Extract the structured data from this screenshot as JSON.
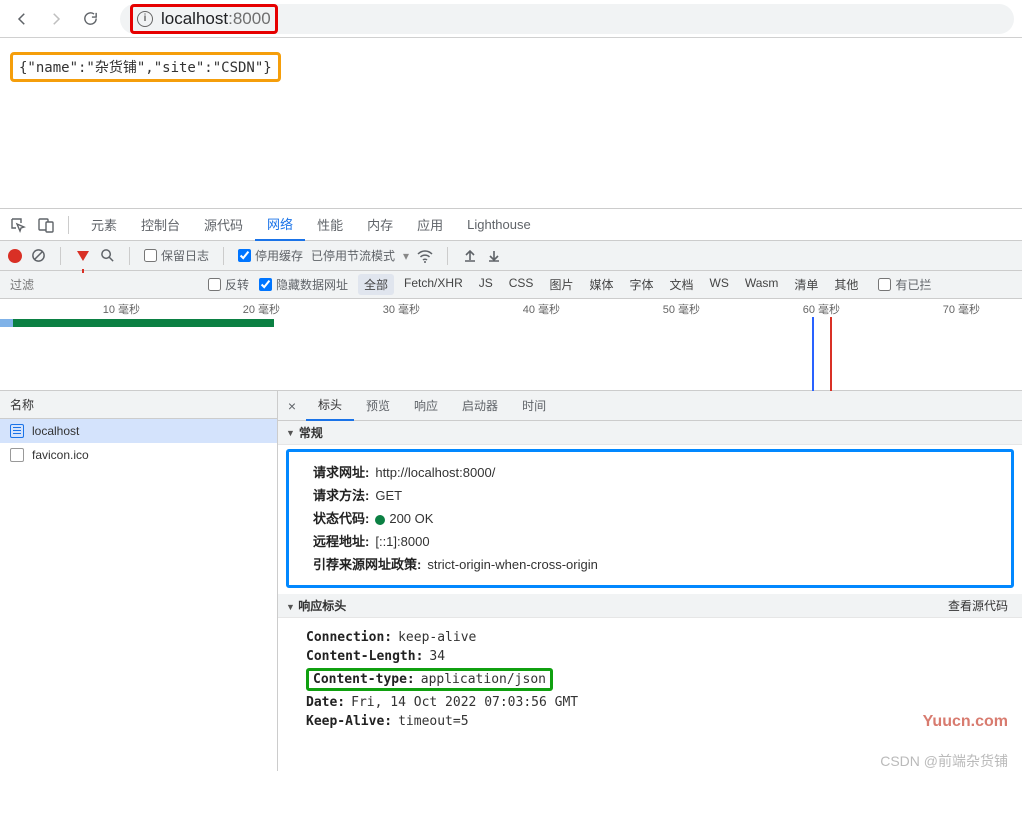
{
  "browser": {
    "address_host": "localhost",
    "address_port": ":8000"
  },
  "page_content": {
    "json_text": "{\"name\":\"杂货铺\",\"site\":\"CSDN\"}"
  },
  "devtools": {
    "tabs": [
      "元素",
      "控制台",
      "源代码",
      "网络",
      "性能",
      "内存",
      "应用",
      "Lighthouse"
    ],
    "active_tab": 3,
    "toolbar": {
      "preserve_log": "保留日志",
      "disable_cache": "停用缓存",
      "throttling_stopped": "已停用节流模式"
    },
    "filter": {
      "placeholder": "过滤",
      "invert": "反转",
      "hide_data": "隐藏数据网址",
      "types": [
        "全部",
        "Fetch/XHR",
        "JS",
        "CSS",
        "图片",
        "媒体",
        "字体",
        "文档",
        "WS",
        "Wasm",
        "清单",
        "其他"
      ],
      "active_type": 0,
      "blocked": "有已拦"
    },
    "timeline": {
      "labels": [
        "10 毫秒",
        "20 毫秒",
        "30 毫秒",
        "40 毫秒",
        "50 毫秒",
        "60 毫秒",
        "70 毫秒"
      ]
    },
    "requests": {
      "header": "名称",
      "items": [
        "localhost",
        "favicon.ico"
      ],
      "selected": 0
    },
    "detail": {
      "tabs": [
        "标头",
        "预览",
        "响应",
        "启动器",
        "时间"
      ],
      "active": 0,
      "general": {
        "title": "常规",
        "rows": [
          {
            "k": "请求网址:",
            "v": "http://localhost:8000/"
          },
          {
            "k": "请求方法:",
            "v": "GET"
          },
          {
            "k": "状态代码:",
            "v": "200 OK",
            "status": true
          },
          {
            "k": "远程地址:",
            "v": "[::1]:8000"
          },
          {
            "k": "引荐来源网址政策:",
            "v": "strict-origin-when-cross-origin"
          }
        ]
      },
      "response": {
        "title": "响应标头",
        "view_source": "查看源代码",
        "rows": [
          {
            "k": "Connection:",
            "v": "keep-alive"
          },
          {
            "k": "Content-Length:",
            "v": "34"
          },
          {
            "k": "Content-type:",
            "v": "application/json",
            "green": true
          },
          {
            "k": "Date:",
            "v": "Fri, 14 Oct 2022 07:03:56 GMT"
          },
          {
            "k": "Keep-Alive:",
            "v": "timeout=5"
          }
        ]
      }
    }
  },
  "watermarks": {
    "w1": "Yuucn.com",
    "w2": "CSDN @前端杂货铺"
  }
}
